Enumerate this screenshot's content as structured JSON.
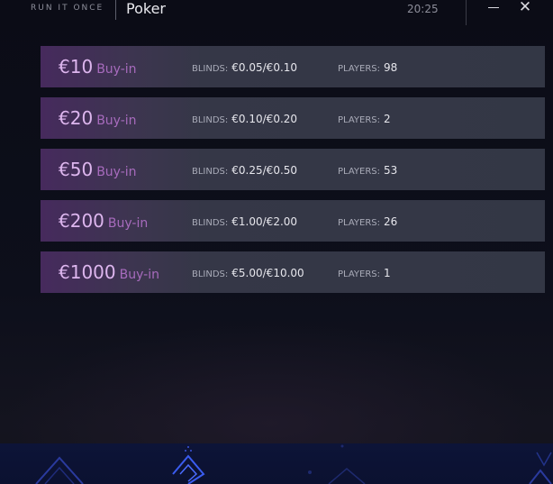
{
  "header": {
    "brand": "RUN IT ONCE",
    "title": "Poker",
    "clock": "20:25"
  },
  "window_controls": {
    "minimize_icon": "minimize-icon",
    "close_icon": "close-icon",
    "close_glyph": "✕"
  },
  "labels": {
    "buyin": "Buy-in",
    "blinds": "BLINDS:",
    "players": "PLAYERS:"
  },
  "tables": [
    {
      "amount": "€10",
      "blinds": "€0.05/€0.10",
      "players": "98"
    },
    {
      "amount": "€20",
      "blinds": "€0.10/€0.20",
      "players": "2"
    },
    {
      "amount": "€50",
      "blinds": "€0.25/€0.50",
      "players": "53"
    },
    {
      "amount": "€200",
      "blinds": "€1.00/€2.00",
      "players": "26"
    },
    {
      "amount": "€1000",
      "blinds": "€5.00/€10.00",
      "players": "1"
    }
  ],
  "colors": {
    "accent_purple": "#ddb6ee",
    "buyin_label": "#a76bbd",
    "row_bg": "#333745",
    "deco_blue": "#2b43c9"
  }
}
